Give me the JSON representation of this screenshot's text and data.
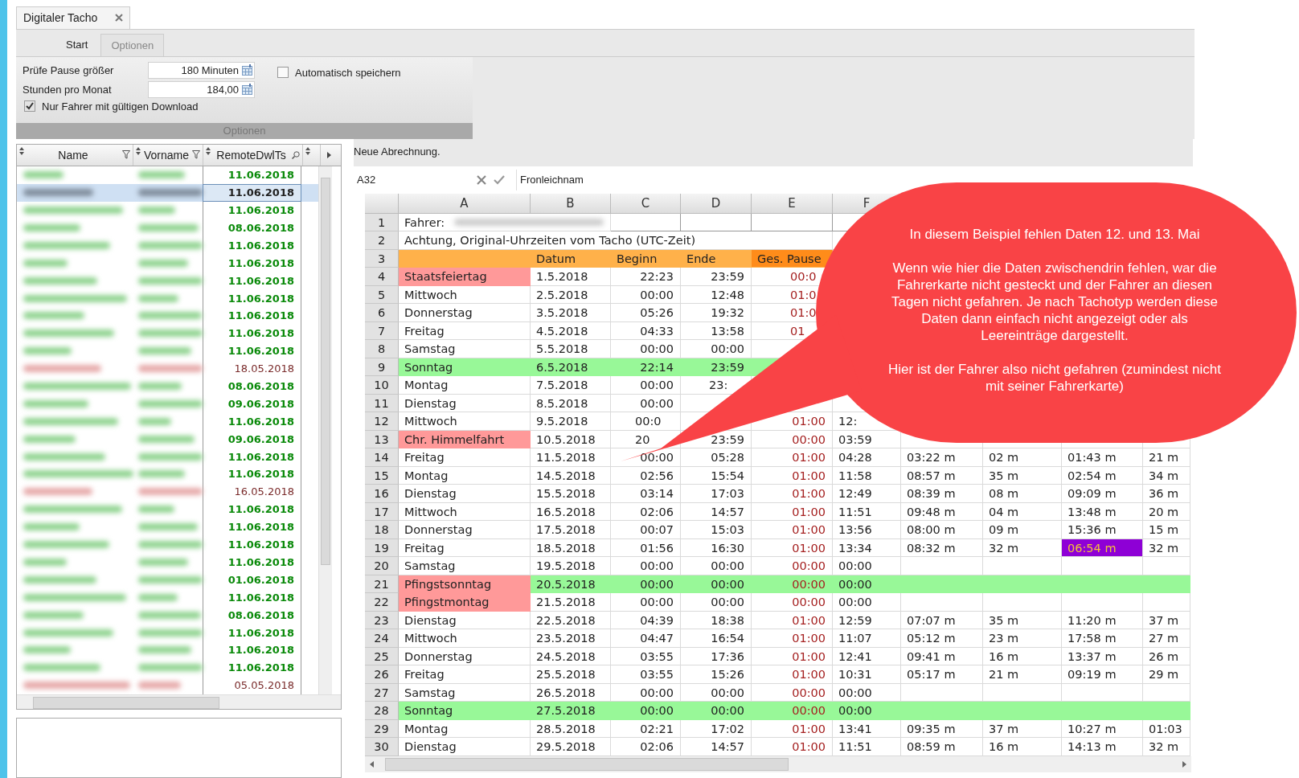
{
  "document_tab": {
    "title": "Digitaler Tacho"
  },
  "ribbon_tabs": [
    {
      "label": "Start",
      "selected": false
    },
    {
      "label": "Optionen",
      "selected": true
    }
  ],
  "options": {
    "fields": [
      {
        "label": "Prüfe Pause größer",
        "value": "180 Minuten"
      },
      {
        "label": "Stunden pro Monat",
        "value": "184,00"
      }
    ],
    "auto_save": {
      "label": "Automatisch speichern",
      "checked": false
    },
    "valid_download_only": {
      "label": "Nur Fahrer mit gültigen Download",
      "checked": true
    },
    "group_label": "Optionen"
  },
  "driver_list": {
    "columns": [
      "Name",
      "Vorname",
      "RemoteDwlTs"
    ],
    "rows": [
      {
        "date": "11.06.2018",
        "overdue": false,
        "selected": false
      },
      {
        "date": "11.06.2018",
        "overdue": false,
        "selected": true
      },
      {
        "date": "11.06.2018",
        "overdue": false,
        "selected": false
      },
      {
        "date": "08.06.2018",
        "overdue": false,
        "selected": false
      },
      {
        "date": "11.06.2018",
        "overdue": false,
        "selected": false
      },
      {
        "date": "11.06.2018",
        "overdue": false,
        "selected": false
      },
      {
        "date": "11.06.2018",
        "overdue": false,
        "selected": false
      },
      {
        "date": "11.06.2018",
        "overdue": false,
        "selected": false
      },
      {
        "date": "11.06.2018",
        "overdue": false,
        "selected": false
      },
      {
        "date": "11.06.2018",
        "overdue": false,
        "selected": false
      },
      {
        "date": "11.06.2018",
        "overdue": false,
        "selected": false
      },
      {
        "date": "18.05.2018",
        "overdue": true,
        "selected": false
      },
      {
        "date": "08.06.2018",
        "overdue": false,
        "selected": false
      },
      {
        "date": "09.06.2018",
        "overdue": false,
        "selected": false
      },
      {
        "date": "11.06.2018",
        "overdue": false,
        "selected": false
      },
      {
        "date": "09.06.2018",
        "overdue": false,
        "selected": false
      },
      {
        "date": "11.06.2018",
        "overdue": false,
        "selected": false
      },
      {
        "date": "11.06.2018",
        "overdue": false,
        "selected": false
      },
      {
        "date": "16.05.2018",
        "overdue": true,
        "selected": false
      },
      {
        "date": "11.06.2018",
        "overdue": false,
        "selected": false
      },
      {
        "date": "11.06.2018",
        "overdue": false,
        "selected": false
      },
      {
        "date": "11.06.2018",
        "overdue": false,
        "selected": false
      },
      {
        "date": "11.06.2018",
        "overdue": false,
        "selected": false
      },
      {
        "date": "01.06.2018",
        "overdue": false,
        "selected": false
      },
      {
        "date": "11.06.2018",
        "overdue": false,
        "selected": false
      },
      {
        "date": "08.06.2018",
        "overdue": false,
        "selected": false
      },
      {
        "date": "11.06.2018",
        "overdue": false,
        "selected": false
      },
      {
        "date": "11.06.2018",
        "overdue": false,
        "selected": false
      },
      {
        "date": "11.06.2018",
        "overdue": false,
        "selected": false
      },
      {
        "date": "05.05.2018",
        "overdue": true,
        "selected": false
      }
    ]
  },
  "sheet": {
    "caption": "Neue Abrechnung.",
    "name_box": "A32",
    "formula": "Fronleichnam",
    "columns": [
      "A",
      "B",
      "C",
      "D",
      "E",
      "F"
    ],
    "rows": [
      {
        "number": "1",
        "kind": "driver",
        "label": "Fahrer:"
      },
      {
        "number": "2",
        "kind": "note",
        "text": "Achtung, Original-Uhrzeiten vom Tacho (UTC-Zeit)"
      },
      {
        "number": "3",
        "kind": "header",
        "cells": [
          "Datum",
          "Beginn",
          "Ende",
          "Ges. Pause"
        ]
      },
      {
        "number": "4",
        "kind": "day",
        "holiday": true,
        "sunday": false,
        "cells": [
          "Staatsfeiertag",
          "1.5.2018",
          "22:23",
          "23:59",
          {
            "text": "00:0",
            "cut": true
          },
          null,
          null,
          null,
          null,
          null
        ]
      },
      {
        "number": "5",
        "kind": "day",
        "holiday": false,
        "sunday": false,
        "cells": [
          "Mittwoch",
          "2.5.2018",
          "00:00",
          "12:48",
          {
            "text": "01:0",
            "cut": true
          },
          null,
          null,
          null,
          null,
          null
        ]
      },
      {
        "number": "6",
        "kind": "day",
        "holiday": false,
        "sunday": false,
        "cells": [
          "Donnerstag",
          "3.5.2018",
          "05:26",
          "19:32",
          {
            "text": "01:0",
            "cut": true
          },
          null,
          null,
          null,
          null,
          null
        ]
      },
      {
        "number": "7",
        "kind": "day",
        "holiday": false,
        "sunday": false,
        "cells": [
          "Freitag",
          "4.5.2018",
          "04:33",
          "13:58",
          {
            "text": "01",
            "cut": true
          },
          null,
          null,
          null,
          null,
          null
        ]
      },
      {
        "number": "8",
        "kind": "day",
        "holiday": false,
        "sunday": false,
        "cells": [
          "Samstag",
          "5.5.2018",
          "00:00",
          "00:00",
          null,
          null,
          null,
          null,
          null,
          null
        ]
      },
      {
        "number": "9",
        "kind": "day",
        "holiday": false,
        "sunday": true,
        "cells": [
          "Sonntag",
          "6.5.2018",
          "22:14",
          "23:59",
          null,
          null,
          null,
          null,
          null,
          null
        ]
      },
      {
        "number": "10",
        "kind": "day",
        "holiday": false,
        "sunday": false,
        "cells": [
          "Montag",
          "7.5.2018",
          "00:00",
          {
            "text": "23:",
            "cut": true
          },
          null,
          null,
          null,
          null,
          null,
          null
        ]
      },
      {
        "number": "11",
        "kind": "day",
        "holiday": false,
        "sunday": false,
        "cells": [
          "Dienstag",
          "8.5.2018",
          "00:00",
          null,
          null,
          null,
          null,
          null,
          null,
          null
        ]
      },
      {
        "number": "12",
        "kind": "day",
        "holiday": false,
        "sunday": false,
        "cells": [
          "Mittwoch",
          "9.5.2018",
          {
            "text": "00:0",
            "cut": true
          },
          null,
          "01:00",
          {
            "text": "12:",
            "cut": true
          },
          null,
          null,
          null,
          null
        ]
      },
      {
        "number": "13",
        "kind": "day",
        "holiday": true,
        "sunday": false,
        "cells": [
          "Chr. Himmelfahrt",
          "10.5.2018",
          {
            "text": "20",
            "cut": true
          },
          "23:59",
          "00:00",
          "03:59",
          null,
          null,
          null,
          null
        ]
      },
      {
        "number": "14",
        "kind": "day",
        "holiday": false,
        "sunday": false,
        "cells": [
          "Freitag",
          "11.5.2018",
          "00:00",
          "05:28",
          "01:00",
          "04:28",
          "03:22 m",
          "02 m",
          "01:43 m",
          "21 m"
        ]
      },
      {
        "number": "15",
        "kind": "day",
        "holiday": false,
        "sunday": false,
        "cells": [
          "Montag",
          "14.5.2018",
          "02:56",
          "15:54",
          "01:00",
          "11:58",
          "08:57 m",
          "35 m",
          "02:54 m",
          "34 m"
        ]
      },
      {
        "number": "16",
        "kind": "day",
        "holiday": false,
        "sunday": false,
        "cells": [
          "Dienstag",
          "15.5.2018",
          "03:14",
          "17:03",
          "01:00",
          "12:49",
          "08:39 m",
          "08 m",
          "09:09 m",
          "36 m"
        ]
      },
      {
        "number": "17",
        "kind": "day",
        "holiday": false,
        "sunday": false,
        "cells": [
          "Mittwoch",
          "16.5.2018",
          "02:06",
          "14:57",
          "01:00",
          "11:51",
          "09:48 m",
          "04 m",
          "13:48 m",
          "20 m"
        ]
      },
      {
        "number": "18",
        "kind": "day",
        "holiday": false,
        "sunday": false,
        "cells": [
          "Donnerstag",
          "17.5.2018",
          "00:07",
          "15:03",
          "01:00",
          "13:56",
          "08:00 m",
          "09 m",
          "15:36 m",
          "15 m"
        ]
      },
      {
        "number": "19",
        "kind": "day",
        "holiday": false,
        "sunday": false,
        "cells": [
          "Freitag",
          "18.5.2018",
          "01:56",
          "16:30",
          "01:00",
          "13:34",
          "08:32 m",
          "32 m",
          {
            "text": "06:54 m",
            "flagged": true
          },
          "32 m"
        ]
      },
      {
        "number": "20",
        "kind": "day",
        "holiday": false,
        "sunday": false,
        "cells": [
          "Samstag",
          "19.5.2018",
          "00:00",
          "00:00",
          "00:00",
          "00:00",
          null,
          null,
          null,
          null
        ]
      },
      {
        "number": "21",
        "kind": "day",
        "holiday": true,
        "sunday": true,
        "cells": [
          "Pfingstsonntag",
          "20.5.2018",
          "00:00",
          "00:00",
          "00:00",
          "00:00",
          null,
          null,
          null,
          null
        ]
      },
      {
        "number": "22",
        "kind": "day",
        "holiday": true,
        "sunday": false,
        "cells": [
          "Pfingstmontag",
          "21.5.2018",
          "00:00",
          "00:00",
          "00:00",
          "00:00",
          null,
          null,
          null,
          null
        ]
      },
      {
        "number": "23",
        "kind": "day",
        "holiday": false,
        "sunday": false,
        "cells": [
          "Dienstag",
          "22.5.2018",
          "04:39",
          "18:38",
          "01:00",
          "12:59",
          "07:07 m",
          "35 m",
          "11:20 m",
          "37 m"
        ]
      },
      {
        "number": "24",
        "kind": "day",
        "holiday": false,
        "sunday": false,
        "cells": [
          "Mittwoch",
          "23.5.2018",
          "04:47",
          "16:54",
          "01:00",
          "11:07",
          "05:12 m",
          "23 m",
          "17:58 m",
          "27 m"
        ]
      },
      {
        "number": "25",
        "kind": "day",
        "holiday": false,
        "sunday": false,
        "cells": [
          "Donnerstag",
          "24.5.2018",
          "03:55",
          "17:36",
          "01:00",
          "12:41",
          "09:41 m",
          "16 m",
          "13:37 m",
          "26 m"
        ]
      },
      {
        "number": "26",
        "kind": "day",
        "holiday": false,
        "sunday": false,
        "cells": [
          "Freitag",
          "25.5.2018",
          "03:55",
          "15:26",
          "01:00",
          "10:31",
          "05:17 m",
          "21 m",
          "09:19 m",
          "29 m"
        ]
      },
      {
        "number": "27",
        "kind": "day",
        "holiday": false,
        "sunday": false,
        "cells": [
          "Samstag",
          "26.5.2018",
          "00:00",
          "00:00",
          "00:00",
          "00:00",
          null,
          null,
          null,
          null
        ]
      },
      {
        "number": "28",
        "kind": "day",
        "holiday": false,
        "sunday": true,
        "cells": [
          "Sonntag",
          "27.5.2018",
          "00:00",
          "00:00",
          "00:00",
          "00:00",
          null,
          null,
          null,
          null
        ]
      },
      {
        "number": "29",
        "kind": "day",
        "holiday": false,
        "sunday": false,
        "cells": [
          "Montag",
          "28.5.2018",
          "02:21",
          "17:02",
          "01:00",
          "13:41",
          "09:35 m",
          "37 m",
          "10:27 m",
          "01:03"
        ]
      },
      {
        "number": "30",
        "kind": "day",
        "holiday": false,
        "sunday": false,
        "cells": [
          "Dienstag",
          "29.5.2018",
          "02:06",
          "14:57",
          "01:00",
          "11:51",
          "08:59 m",
          "16 m",
          "14:13 m",
          "32 m"
        ]
      }
    ]
  },
  "callout": {
    "paragraphs": [
      "In diesem Beispiel fehlen Daten 12. und 13. Mai",
      "Wenn wie hier die Daten zwischendrin fehlen, war die Fahrerkarte nicht gesteckt und der Fahrer an diesen Tagen nicht gefahren. Je nach Tachotyp werden diese Daten dann einfach nicht angezeigt oder als Leereinträge dargestellt.",
      "Hier ist der Fahrer also nicht gefahren (zumindest nicht mit seiner Fahrerkarte)"
    ]
  }
}
